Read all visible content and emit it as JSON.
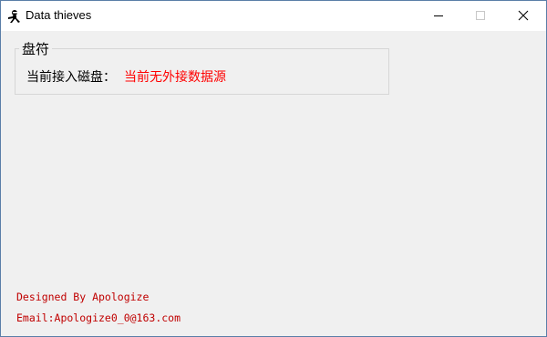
{
  "window": {
    "title": "Data thieves",
    "app_icon": "ninja-icon"
  },
  "controls": {
    "minimize_icon": "minimize-icon",
    "maximize_icon": "maximize-icon",
    "close_icon": "close-icon"
  },
  "drive_group": {
    "legend": "盘符",
    "label": "当前接入磁盘：",
    "status": "当前无外接数据源",
    "status_color": "#ff0000"
  },
  "footer": {
    "designed_by": "Designed By Apologize",
    "email": "Email:Apologize0_0@163.com",
    "text_color": "#c00000"
  }
}
